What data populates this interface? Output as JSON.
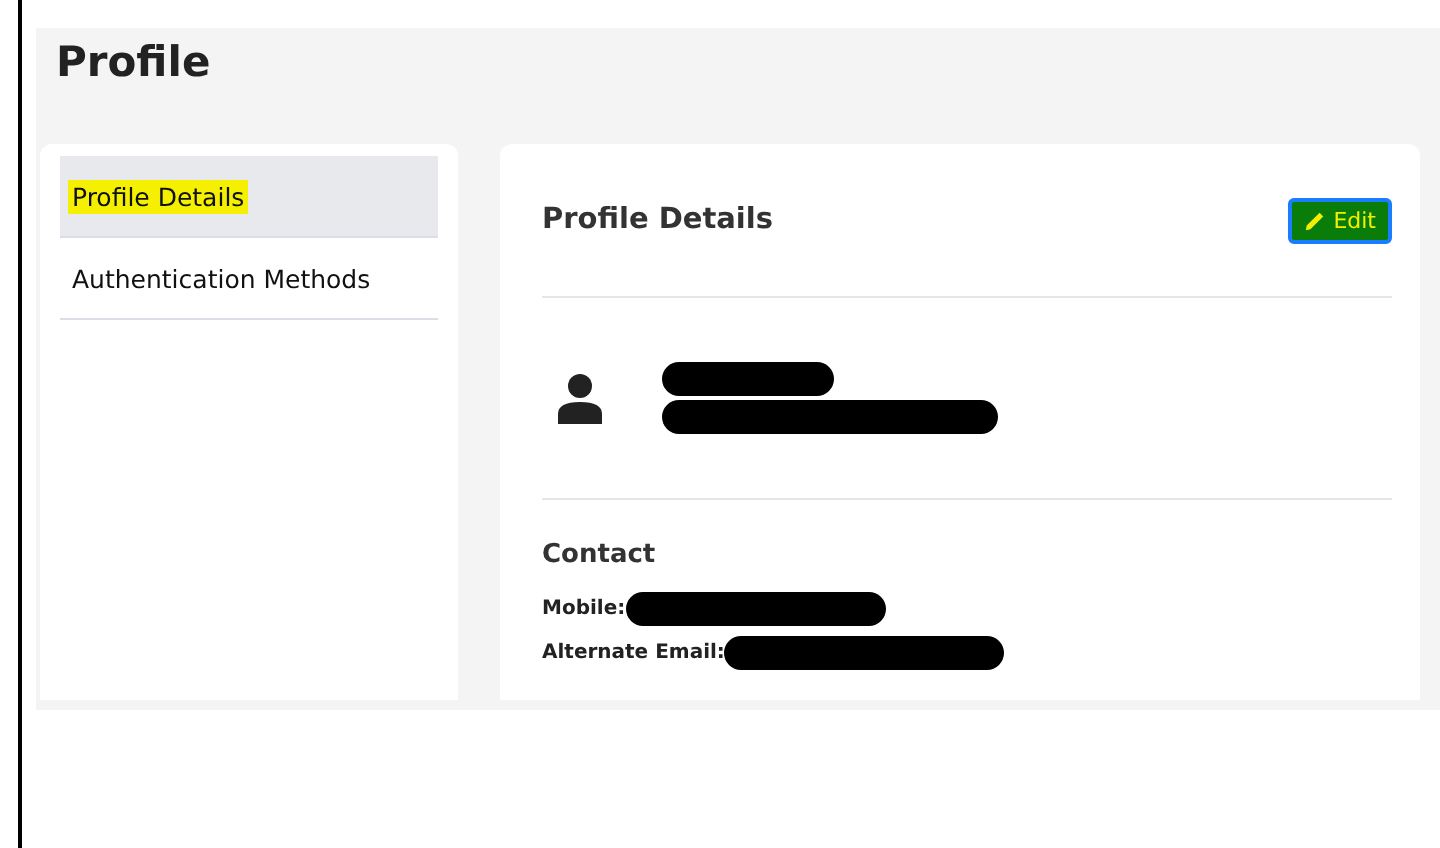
{
  "page": {
    "title": "Profile"
  },
  "sidebar": {
    "items": [
      {
        "label": "Profile Details",
        "selected": true,
        "highlighted": true
      },
      {
        "label": "Authentication Methods",
        "selected": false,
        "highlighted": false
      }
    ]
  },
  "details": {
    "title": "Profile Details",
    "edit_button": {
      "label": "Edit"
    },
    "contact": {
      "title": "Contact",
      "fields": [
        {
          "label": "Mobile:"
        },
        {
          "label": "Alternate Email:"
        }
      ]
    }
  }
}
